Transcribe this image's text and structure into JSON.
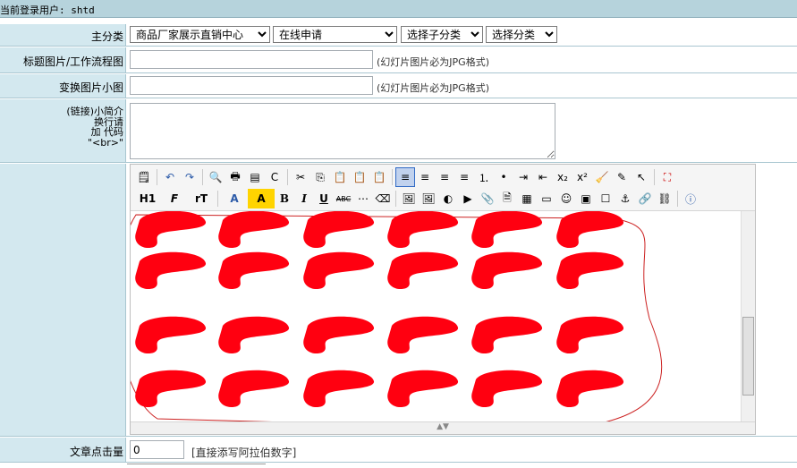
{
  "header": {
    "login_text": "当前登录用户: shtd"
  },
  "main_category": {
    "label": "主分类",
    "select1": "商品厂家展示直销中心",
    "select2": "在线申请",
    "select3": "选择子分类",
    "select4": "选择分类"
  },
  "title_image": {
    "label": "标题图片/工作流程图",
    "value": "",
    "hint": "(幻灯片图片必为JPG格式)"
  },
  "thumb_image": {
    "label": "变换图片小图",
    "value": "",
    "hint": "(幻灯片图片必为JPG格式)"
  },
  "intro": {
    "label_lines": [
      "(链接)小简介",
      "换行请",
      "加 代码",
      "\"<br>\""
    ],
    "value": ""
  },
  "editor": {
    "toolbar_row1": [
      "source-icon",
      "undo-icon",
      "redo-icon",
      "preview-icon",
      "print-icon",
      "template-icon",
      "code-icon",
      "cut-icon",
      "copy-icon",
      "paste-icon",
      "paste-text-icon",
      "paste-word-icon",
      "align-left-icon",
      "align-center-icon",
      "align-right-icon",
      "justify-icon",
      "ordered-list-icon",
      "unordered-list-icon",
      "indent-icon",
      "outdent-icon",
      "subscript-icon",
      "superscript-icon",
      "clear-format-icon",
      "select-all-icon",
      "cursor-icon",
      "fullscreen-icon"
    ],
    "toolbar_row2_labels": [
      "H1",
      "F",
      "rT",
      "A",
      "A",
      "B",
      "I",
      "U",
      "ABC"
    ],
    "colors": {
      "scribble": "#ff0010",
      "outline": "#c22"
    }
  },
  "click_count": {
    "label": "文章点击量",
    "value": "0",
    "hint": "[直接添写阿拉伯数字]"
  }
}
